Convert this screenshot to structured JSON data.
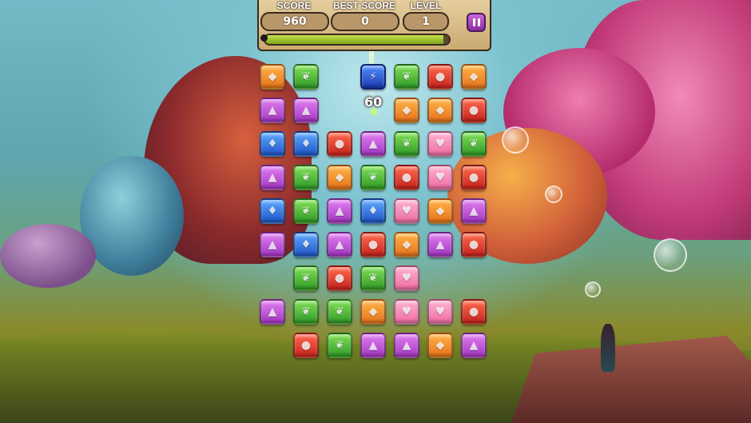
{
  "hud": {
    "score": {
      "label": "SCORE",
      "value": "960"
    },
    "best_score": {
      "label": "BEST SCORE",
      "value": "0"
    },
    "level": {
      "label": "LEVEL",
      "value": "1"
    },
    "progress": 0.97,
    "pause_icon": "pause-icon"
  },
  "popup": {
    "points": "60"
  },
  "board": {
    "rows": [
      [
        "orange",
        "green",
        "special",
        "green",
        "red",
        "orange"
      ],
      [
        "purple",
        "purple",
        "",
        "orange",
        "orange",
        "red"
      ],
      [
        "blue",
        "blue",
        "red",
        "purple",
        "green",
        "pink",
        "green"
      ],
      [
        "purple",
        "green",
        "orange",
        "green",
        "red",
        "pink",
        "red"
      ],
      [
        "blue",
        "green",
        "purple",
        "blue",
        "pink",
        "orange",
        "purple"
      ],
      [
        "purple",
        "blue",
        "purple",
        "red",
        "orange",
        "purple",
        "red"
      ],
      [
        "green",
        "red",
        "green",
        "pink"
      ],
      [
        "purple",
        "green",
        "green",
        "orange",
        "pink",
        "pink",
        "red"
      ],
      [
        "red",
        "green",
        "purple",
        "purple",
        "orange",
        "purple"
      ]
    ]
  },
  "colors": {
    "orange": "#f39a2c",
    "green": "#4cbd36",
    "red": "#e03a2c",
    "purple": "#c458dc",
    "blue": "#3a7ee8",
    "pink": "#f58ab8"
  }
}
